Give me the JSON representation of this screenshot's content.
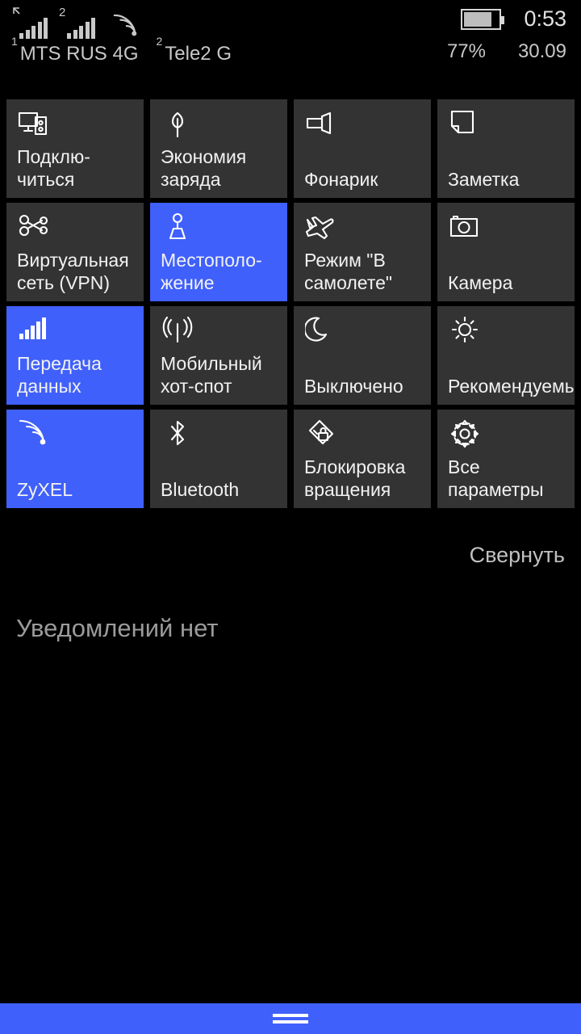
{
  "statusbar": {
    "sim1": {
      "label": "MTS RUS",
      "network": "4G",
      "index": "1",
      "bars": 5,
      "roaming_icon": "roaming-arrow-icon"
    },
    "sim2": {
      "label": "Tele2",
      "network": "G",
      "index": "2",
      "bars": 5
    },
    "wifi_icon": "wifi-icon",
    "battery": {
      "percent": "77%",
      "fill_ratio": 0.77,
      "icon": "battery-icon"
    },
    "clock": "0:53",
    "date": "30.09"
  },
  "tiles": [
    {
      "label": "Подклю-\nчиться",
      "icon": "connect-icon",
      "state": "off"
    },
    {
      "label": "Экономия\nзаряда",
      "icon": "battery-saver-icon",
      "state": "off"
    },
    {
      "label": "Фонарик",
      "icon": "flashlight-icon",
      "state": "off"
    },
    {
      "label": "Заметка",
      "icon": "note-icon",
      "state": "off"
    },
    {
      "label": "Виртуальная\nсеть (VPN)",
      "icon": "vpn-icon",
      "state": "off"
    },
    {
      "label": "Местополо-\nжение",
      "icon": "location-icon",
      "state": "on"
    },
    {
      "label": "Режим \"В\nсамолете\"",
      "icon": "airplane-icon",
      "state": "off"
    },
    {
      "label": "Камера",
      "icon": "camera-icon",
      "state": "off"
    },
    {
      "label": "Передача\nданных",
      "icon": "cellular-data-icon",
      "state": "on"
    },
    {
      "label": "Мобильный\nхот-спот",
      "icon": "hotspot-icon",
      "state": "off"
    },
    {
      "label": "Выключено",
      "icon": "quiet-hours-icon",
      "state": "off"
    },
    {
      "label": "Рекомендуемы",
      "icon": "brightness-icon",
      "state": "off"
    },
    {
      "label": "ZyXEL",
      "icon": "wifi-icon",
      "state": "on"
    },
    {
      "label": "Bluetooth",
      "icon": "bluetooth-icon",
      "state": "off"
    },
    {
      "label": "Блокировка\nвращения",
      "icon": "rotation-lock-icon",
      "state": "off"
    },
    {
      "label": "Все\nпараметры",
      "icon": "settings-gear-icon",
      "state": "off"
    }
  ],
  "collapse_label": "Свернуть",
  "notifications": {
    "empty_text": "Уведомлений нет"
  },
  "navbar": {
    "handle_icon": "drag-handle-icon"
  },
  "colors": {
    "accent": "#4060fb",
    "tile_off": "#333333",
    "background": "#000000",
    "text": "#f2f2f2",
    "muted_text": "#9b9b9b"
  }
}
